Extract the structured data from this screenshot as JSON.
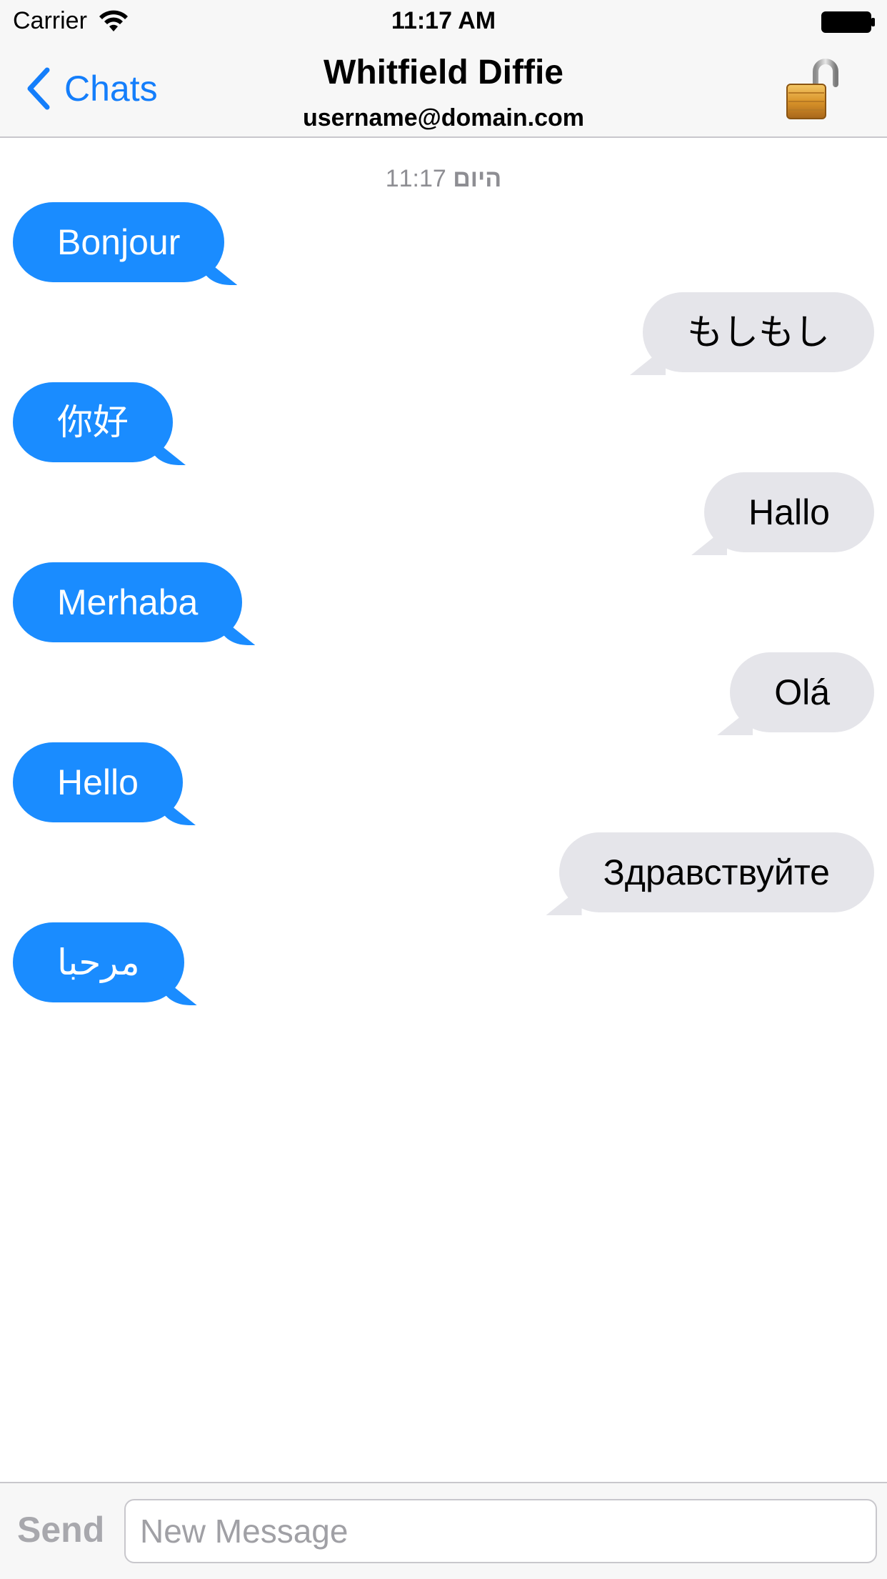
{
  "status_bar": {
    "carrier": "Carrier",
    "time": "11:17 AM",
    "icons": [
      "wifi-icon",
      "battery-icon"
    ]
  },
  "nav": {
    "back_label": "Chats",
    "title": "Whitfield Diffie",
    "subtitle": "username@domain.com",
    "lock_icon": "unlocked-padlock-icon",
    "back_icon": "chevron-left-icon"
  },
  "conversation": {
    "timestamp_day": "היום",
    "timestamp_time": "11:17",
    "messages": [
      {
        "direction": "incoming",
        "text": "Bonjour"
      },
      {
        "direction": "outgoing",
        "text": "もしもし"
      },
      {
        "direction": "incoming",
        "text": "你好"
      },
      {
        "direction": "outgoing",
        "text": "Hallo"
      },
      {
        "direction": "incoming",
        "text": "Merhaba"
      },
      {
        "direction": "outgoing",
        "text": "Olá"
      },
      {
        "direction": "incoming",
        "text": "Hello"
      },
      {
        "direction": "outgoing",
        "text": "Здравствуйте"
      },
      {
        "direction": "incoming",
        "text": "مرحبا"
      }
    ]
  },
  "composer": {
    "send_label": "Send",
    "placeholder": "New Message",
    "value": ""
  },
  "colors": {
    "accent": "#147efb",
    "incoming_bubble": "#1a8cff",
    "outgoing_bubble": "#e5e5ea",
    "bar_background": "#f7f7f7"
  }
}
